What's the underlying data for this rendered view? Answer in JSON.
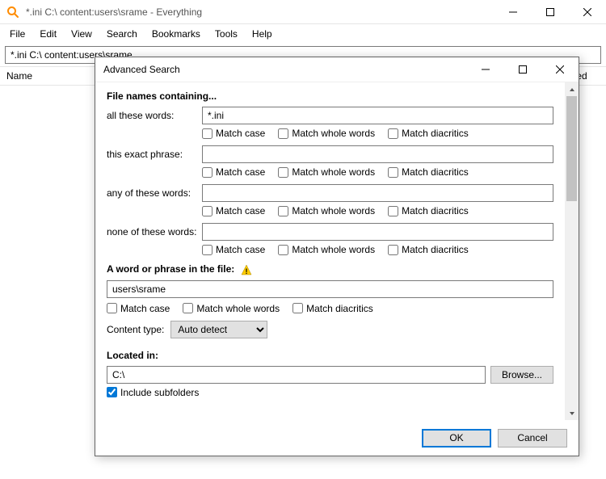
{
  "app": {
    "title": "*.ini C:\\ content:users\\srame - Everything"
  },
  "menubar": [
    "File",
    "Edit",
    "View",
    "Search",
    "Bookmarks",
    "Tools",
    "Help"
  ],
  "searchbar": {
    "value": "*.ini C:\\ content:users\\srame"
  },
  "columns": {
    "name": "Name",
    "date_modified": "te Modified"
  },
  "dialog": {
    "title": "Advanced Search",
    "section1_header": "File names containing...",
    "all_words_label": "all these words:",
    "all_words_value": "*.ini",
    "exact_phrase_label": "this exact phrase:",
    "exact_phrase_value": "",
    "any_words_label": "any of these words:",
    "any_words_value": "",
    "none_words_label": "none of these words:",
    "none_words_value": "",
    "chk_match_case": "Match case",
    "chk_whole_words": "Match whole words",
    "chk_diacritics": "Match diacritics",
    "section2_header": "A word or phrase in the file:",
    "content_value": "users\\srame",
    "content_type_label": "Content type:",
    "content_type_value": "Auto detect",
    "section3_header": "Located in:",
    "located_value": "C:\\",
    "browse_label": "Browse...",
    "include_subfolders_label": "Include subfolders",
    "include_subfolders_checked": true,
    "ok": "OK",
    "cancel": "Cancel"
  }
}
